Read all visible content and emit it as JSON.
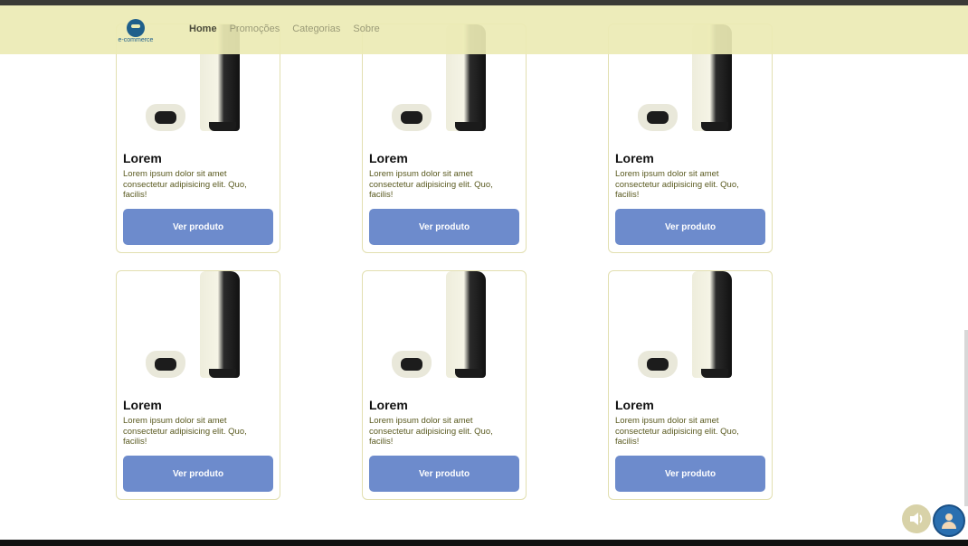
{
  "nav": {
    "logo_text": "e-commerce",
    "links": [
      "Home",
      "Promoções",
      "Categorias",
      "Sobre"
    ]
  },
  "cards": [
    {
      "title": "Lorem",
      "desc": "Lorem ipsum dolor sit amet consectetur adipisicing elit. Quo, facilis!",
      "button": "Ver produto"
    },
    {
      "title": "Lorem",
      "desc": "Lorem ipsum dolor sit amet consectetur adipisicing elit. Quo, facilis!",
      "button": "Ver produto"
    },
    {
      "title": "Lorem",
      "desc": "Lorem ipsum dolor sit amet consectetur adipisicing elit. Quo, facilis!",
      "button": "Ver produto"
    },
    {
      "title": "Lorem",
      "desc": "Lorem ipsum dolor sit amet consectetur adipisicing elit. Quo, facilis!",
      "button": "Ver produto"
    },
    {
      "title": "Lorem",
      "desc": "Lorem ipsum dolor sit amet consectetur adipisicing elit. Quo, facilis!",
      "button": "Ver produto"
    },
    {
      "title": "Lorem",
      "desc": "Lorem ipsum dolor sit amet consectetur adipisicing elit. Quo, facilis!",
      "button": "Ver produto"
    }
  ],
  "colors": {
    "navbar_bg": "#ecebb4",
    "button_bg": "#6d8bcc",
    "card_border": "#e2dfb0",
    "desc_text": "#5a5a20"
  },
  "icons": {
    "sound": "speaker-icon",
    "accessibility": "accessibility-icon"
  }
}
